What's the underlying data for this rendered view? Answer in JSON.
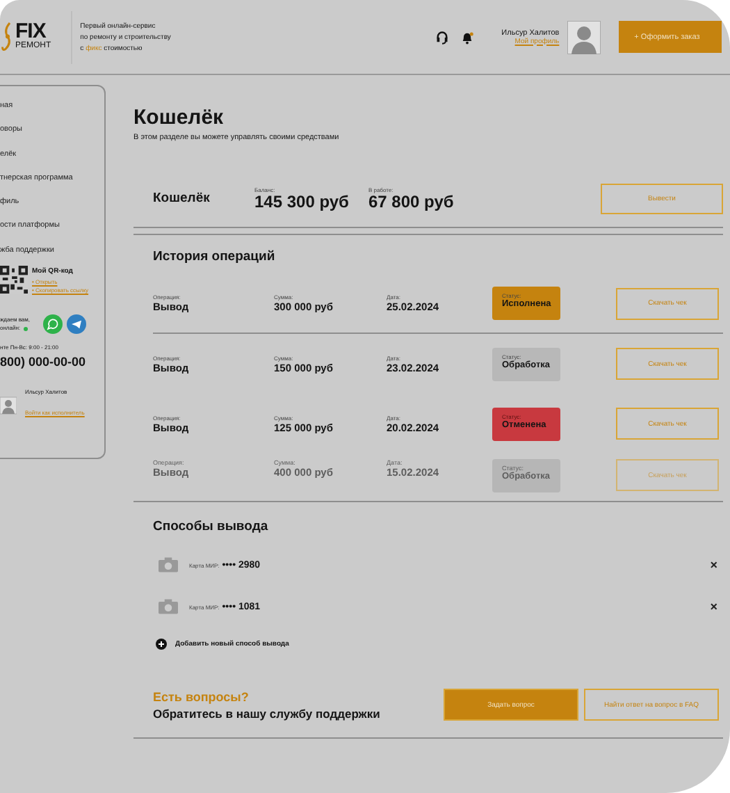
{
  "header": {
    "logo": {
      "title": "FIX",
      "subtitle": "РЕМОНТ"
    },
    "tagline": [
      "Первый онлайн-сервис",
      "по ремонту и строительству",
      "с **фикс** стоимостью"
    ],
    "user": {
      "name": "Ильсур Халитов",
      "link": "Мой профиль"
    },
    "order_button": "+ Оформить заказ"
  },
  "sidebar": {
    "items": [
      {
        "label": "ная"
      },
      {
        "label": "оворы"
      },
      {
        "label": "елёк"
      },
      {
        "label": "тнерская программа"
      },
      {
        "label": "филь"
      },
      {
        "label": "ости платформы"
      },
      {
        "label": "жба поддержки"
      }
    ],
    "qr": {
      "title": "Мой QR-код",
      "links": [
        "• Открыть",
        "• Скопировать ссылку"
      ]
    },
    "online": [
      "ждаем вам,",
      "онлайн:"
    ],
    "hours": "нте Пн-Вс: 9:00 - 21:00",
    "phone": "800) 000-00-00",
    "user": {
      "name": "Ильсур Халитов",
      "link": "Войти как исполнитель"
    }
  },
  "page": {
    "title": "Кошелёк",
    "subtitle": "В этом разделе вы можете управлять своими средствами"
  },
  "wallet": {
    "title": "Кошелёк",
    "balance_label": "Баланс:",
    "balance": "145 300 руб",
    "in_work_label": "В работе:",
    "in_work": "67 800 руб",
    "button": "Вывести"
  },
  "history": {
    "title": "История операций",
    "rows": [
      {
        "operation_label": "Операция:",
        "operation": "Вывод",
        "amount_label": "Сумма:",
        "amount": "300 000 руб",
        "date_label": "Дата:",
        "date": "25.02.2024",
        "status_label": "Статус:",
        "status": "Исполнена",
        "kind": "done",
        "button": "Скачать чек",
        "faded": false
      },
      {
        "operation_label": "Операция:",
        "operation": "Вывод",
        "amount_label": "Сумма:",
        "amount": "150 000 руб",
        "date_label": "Дата:",
        "date": "23.02.2024",
        "status_label": "Статус:",
        "status": "Обработка",
        "kind": "processing",
        "button": "Скачать чек",
        "faded": false
      },
      {
        "operation_label": "Операция:",
        "operation": "Вывод",
        "amount_label": "Сумма:",
        "amount": "125 000 руб",
        "date_label": "Дата:",
        "date": "20.02.2024",
        "status_label": "Статус:",
        "status": "Отменена",
        "kind": "cancelled",
        "button": "Скачать чек",
        "faded": false
      },
      {
        "operation_label": "Операция:",
        "operation": "Вывод",
        "amount_label": "Сумма:",
        "amount": "400 000 руб",
        "date_label": "Дата:",
        "date": "15.02.2024",
        "status_label": "Статус:",
        "status": "Обработка",
        "kind": "processing",
        "button": "Скачать чек",
        "faded": true
      }
    ]
  },
  "methods": {
    "title": "Способы вывода",
    "cards": [
      {
        "label": "Карта МИР:",
        "number": "•••• 2980",
        "remove": "×"
      },
      {
        "label": "Карта МИР:",
        "number": "•••• 1081",
        "remove": "×"
      }
    ],
    "add": "Добавить новый способ вывода"
  },
  "support": {
    "question": "Есть вопросы?",
    "text": "Обратитесь в нашу службу поддержки",
    "ask_button": "Задать вопрос",
    "faq_button": "Найти ответ на вопрос в FAQ"
  }
}
